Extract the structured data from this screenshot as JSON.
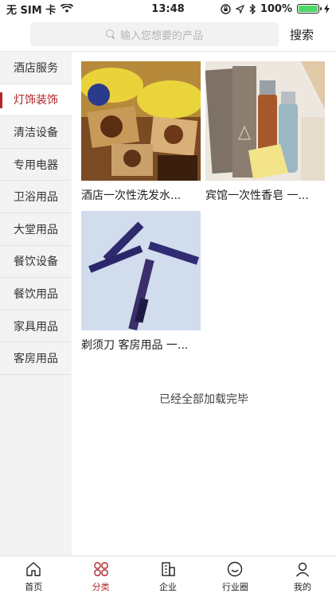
{
  "status_bar": {
    "carrier": "无 SIM 卡",
    "time": "13:48",
    "battery": "100%",
    "icons": [
      "wifi-icon",
      "lock-rotation-icon",
      "location-icon",
      "bluetooth-icon",
      "battery-icon",
      "charging-icon"
    ]
  },
  "search": {
    "placeholder": "输入您想要的产品",
    "button": "搜索"
  },
  "sidebar": {
    "items": [
      {
        "label": "酒店服务"
      },
      {
        "label": "灯饰装饰"
      },
      {
        "label": "清洁设备"
      },
      {
        "label": "专用电器"
      },
      {
        "label": "卫浴用品"
      },
      {
        "label": "大堂用品"
      },
      {
        "label": "餐饮设备"
      },
      {
        "label": "餐饮用品"
      },
      {
        "label": "家具用品"
      },
      {
        "label": "客房用品"
      }
    ],
    "active_index": 1
  },
  "products": [
    {
      "title": "酒店一次性洗发水..."
    },
    {
      "title": "宾馆一次性香皂 一..."
    },
    {
      "title": "剃须刀 客房用品 一..."
    }
  ],
  "end_note": "已经全部加载完毕",
  "tabbar": {
    "tabs": [
      {
        "label": "首页",
        "icon": "home-icon"
      },
      {
        "label": "分类",
        "icon": "category-icon"
      },
      {
        "label": "企业",
        "icon": "building-icon"
      },
      {
        "label": "行业圈",
        "icon": "smile-icon"
      },
      {
        "label": "我的",
        "icon": "user-icon"
      }
    ],
    "active_index": 1
  },
  "colors": {
    "accent": "#b0282c",
    "battery": "#4cd964"
  }
}
